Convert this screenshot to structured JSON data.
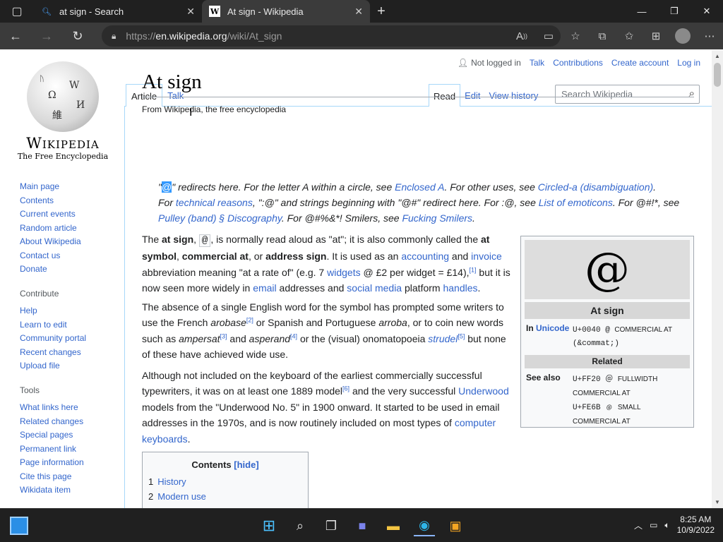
{
  "browser": {
    "tabs": [
      {
        "title": "at sign - Search",
        "active": false
      },
      {
        "title": "At sign - Wikipedia",
        "active": true
      }
    ],
    "url_prefix": "https://",
    "url_domain": "en.wikipedia.org",
    "url_path": "/wiki/At_sign"
  },
  "wiki": {
    "logo_wordmark": "Wikipedia",
    "logo_tagline": "The Free Encyclopedia",
    "nav_main": [
      "Main page",
      "Contents",
      "Current events",
      "Random article",
      "About Wikipedia",
      "Contact us",
      "Donate"
    ],
    "contribute_heading": "Contribute",
    "contribute": [
      "Help",
      "Learn to edit",
      "Community portal",
      "Recent changes",
      "Upload file"
    ],
    "tools_heading": "Tools",
    "tools": [
      "What links here",
      "Related changes",
      "Special pages",
      "Permanent link",
      "Page information",
      "Cite this page",
      "Wikidata item"
    ],
    "personal": {
      "not_logged": "Not logged in",
      "talk": "Talk",
      "contributions": "Contributions",
      "create": "Create account",
      "login": "Log in"
    },
    "tabs_left": [
      "Article",
      "Talk"
    ],
    "tabs_right": [
      "Read",
      "Edit",
      "View history"
    ],
    "search_placeholder": "Search Wikipedia",
    "title": "At sign",
    "from": "From Wikipedia, the free encyclopedia",
    "hatnote": {
      "l1_pre": "\" redirects here. For the letter A within a circle, see ",
      "l1_link1": "Enclosed A",
      "l1_mid": ". For other uses, see ",
      "l1_link2": "Circled-a (disambiguation)",
      "l1_end": ".",
      "l2_pre": "For ",
      "l2_link1": "technical reasons",
      "l2_mid1": ", \":@\" and strings beginning with \"@#\" redirect here. For :@, see ",
      "l2_link2": "List of emoticons",
      "l2_mid2": ". For @#!*, see ",
      "l3_link1": "Pulley (band) § Discography",
      "l3_mid": ". For @#%&*! Smilers, see ",
      "l3_link2": "Fucking Smilers",
      "l3_end": "."
    },
    "p1": {
      "t1": "The ",
      "b1": "at sign",
      "t2": ", ",
      "code": "@",
      "t3": ", is normally read aloud as \"at\"; it is also commonly called the ",
      "b2": "at symbol",
      "t4": ", ",
      "b3": "commercial at",
      "t5": ", or ",
      "b4": "address sign",
      "t6": ". It is used as an ",
      "l1": "accounting",
      "t7": " and ",
      "l2": "invoice",
      "t8": " abbreviation meaning \"at a rate of\" (e.g. 7 ",
      "l3": "widgets",
      "t9": " @ £2 per widget = £14),",
      "s1": "[1]",
      "t10": " but it is now seen more widely in ",
      "l4": "email",
      "t11": " addresses and ",
      "l5": "social media",
      "t12": " platform ",
      "l6": "handles",
      "t13": "."
    },
    "p2": {
      "t1": "The absence of a single English word for the symbol has prompted some writers to use the French ",
      "i1": "arobase",
      "s1": "[2]",
      "t2": " or Spanish and Portuguese ",
      "i2": "arroba",
      "t3": ", or to coin new words such as ",
      "i3": "ampersat",
      "s2": "[3]",
      "t4": " and ",
      "i4": "asperand",
      "s3": "[4]",
      "t5": " or the (visual) onomatopoeia ",
      "l1": "strudel",
      "t6": ".",
      "s4": "[5]",
      "t7": " but none of these have achieved wide use."
    },
    "p3": {
      "t1": "Although not included on the keyboard of the earliest commercially successful typewriters, it was on at least one 1889 model",
      "s1": "[6]",
      "t2": " and the very successful ",
      "l1": "Underwood",
      "t3": " models from the \"Underwood No. 5\" in 1900 onward. It started to be used in email addresses in the 1970s, and is now routinely included on most types of ",
      "l2": "computer keyboards",
      "t4": "."
    },
    "infobox": {
      "symbol": "@",
      "title": "At sign",
      "in_label": "In",
      "in_link": "Unicode",
      "in_val1": "U+0040 @ ",
      "in_val1_sc": "COMMERCIAL AT",
      "in_val2": "(&commat;)",
      "related": "Related",
      "see_also_label": "See also",
      "sa1": "U+FF20 ＠ ",
      "sa1_sc": "FULLWIDTH COMMERCIAL AT",
      "sa2": "U+FE6B ﹫ ",
      "sa2_sc": "SMALL COMMERCIAL AT"
    },
    "toc": {
      "title": "Contents",
      "hide": "[hide]",
      "items": [
        {
          "num": "1",
          "label": "History"
        },
        {
          "num": "2",
          "label": "Modern use"
        }
      ]
    }
  },
  "taskbar": {
    "time": "8:25 AM",
    "date": "10/9/2022"
  },
  "colors": {
    "link": "#3366cc",
    "chrome_dark": "#202020",
    "chrome_mid": "#3b3b3b"
  }
}
